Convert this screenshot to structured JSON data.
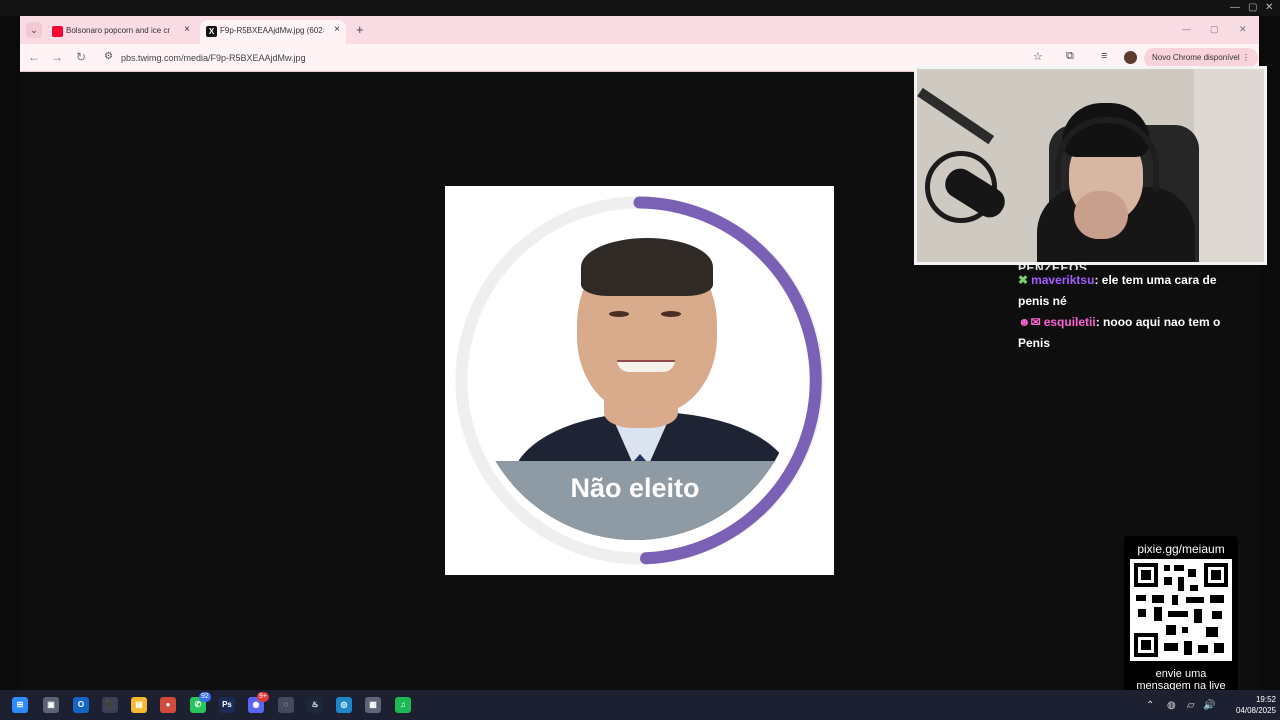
{
  "browser": {
    "tabs": [
      {
        "title": "Bolsonaro popcorn and ice cre",
        "favicon": "youtube-icon"
      },
      {
        "title": "F9p-R5BXEAAjdMw.jpg (602×6",
        "favicon": "x-icon"
      }
    ],
    "url": "pbs.twimg.com/media/F9p-R5BXEAAjdMw.jpg",
    "update_label": "Novo Chrome disponível",
    "icons": {
      "back": "←",
      "forward": "→",
      "reload": "↻",
      "site_info": "⚙",
      "star": "☆",
      "extensions": "⧉",
      "media": "≡",
      "menu": "⋮",
      "new_tab": "+",
      "tab_search": "⌄",
      "close": "×",
      "minimize": "—",
      "maximize": "▢",
      "window_close": "✕"
    }
  },
  "content": {
    "banner_label": "Não eleito",
    "ring_color": "#7b61b5",
    "ring_track": "#efefef"
  },
  "webcam": {
    "label": "streamer webcam"
  },
  "chat": {
    "cutoff": "PENZEEOS",
    "messages": [
      {
        "prefix": "✖",
        "user": "maveriktsu",
        "user_color": "#a35bff",
        "text": "ele tem uma cara de penis né"
      },
      {
        "prefix": "☻✉",
        "user": "esquiletii",
        "user_color": "#ff63d8",
        "text": "nooo aqui nao tem o Penis"
      }
    ]
  },
  "qr": {
    "title": "pixie.gg/meiaum",
    "footer_line1": "envie uma",
    "footer_line2": "mensagem na live"
  },
  "taskbar": {
    "apps": [
      {
        "name": "start-icon",
        "glyph": "⊞",
        "color": "#2e8bff"
      },
      {
        "name": "task-view-icon",
        "glyph": "▣",
        "color": "#5c6375"
      },
      {
        "name": "outlook-icon",
        "glyph": "O",
        "color": "#1366c5"
      },
      {
        "name": "store-icon",
        "glyph": "⬛",
        "color": "#3a3f57"
      },
      {
        "name": "explorer-icon",
        "glyph": "▤",
        "color": "#f3b935"
      },
      {
        "name": "chrome-icon",
        "glyph": "●",
        "color": "#d14a3c"
      },
      {
        "name": "whatsapp-icon",
        "glyph": "✆",
        "color": "#27c55b"
      },
      {
        "name": "photoshop-icon",
        "glyph": "Ps",
        "color": "#1a2b54"
      },
      {
        "name": "discord-icon",
        "glyph": "◉",
        "color": "#5865f2"
      },
      {
        "name": "obs-icon",
        "glyph": "◌",
        "color": "#444b5c"
      },
      {
        "name": "steam-icon",
        "glyph": "♨",
        "color": "#1b2838"
      },
      {
        "name": "globe-icon",
        "glyph": "◎",
        "color": "#1d88c5"
      },
      {
        "name": "calculator-icon",
        "glyph": "▦",
        "color": "#5d6678"
      },
      {
        "name": "spotify-icon",
        "glyph": "♫",
        "color": "#1db954"
      }
    ],
    "badges": [
      {
        "app": "whatsapp-icon",
        "value": "92"
      },
      {
        "app": "discord-icon",
        "value": "9+"
      }
    ],
    "time": "19:52",
    "date": "04/08/2025",
    "tray_icons": [
      "⌃",
      "◍",
      "▱",
      "🔊"
    ]
  }
}
